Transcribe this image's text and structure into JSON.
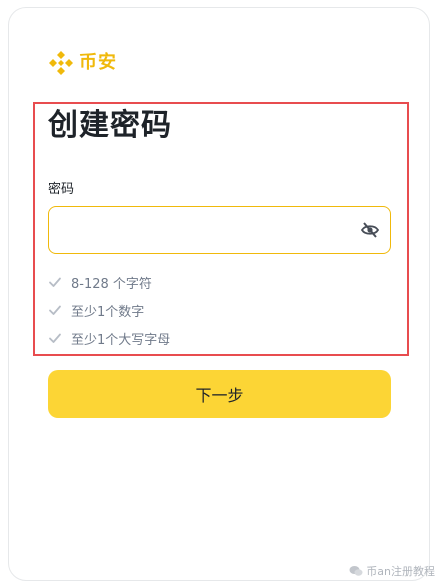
{
  "brand": {
    "name": "币安",
    "color": "#f0b90b",
    "logo_icon": "binance-logo-icon"
  },
  "page": {
    "title": "创建密码"
  },
  "password_field": {
    "label": "密码",
    "value": "",
    "placeholder": "",
    "visibility_icon": "eye-off-icon"
  },
  "requirements": [
    {
      "text": "8-128 个字符",
      "icon": "check-icon"
    },
    {
      "text": "至少1个数字",
      "icon": "check-icon"
    },
    {
      "text": "至少1个大写字母",
      "icon": "check-icon"
    }
  ],
  "next_button": {
    "label": "下一步",
    "color": "#fcd535"
  },
  "highlight_color": "#e84c4f",
  "watermark": {
    "text": "币an注册教程",
    "icon": "wechat-icon"
  }
}
